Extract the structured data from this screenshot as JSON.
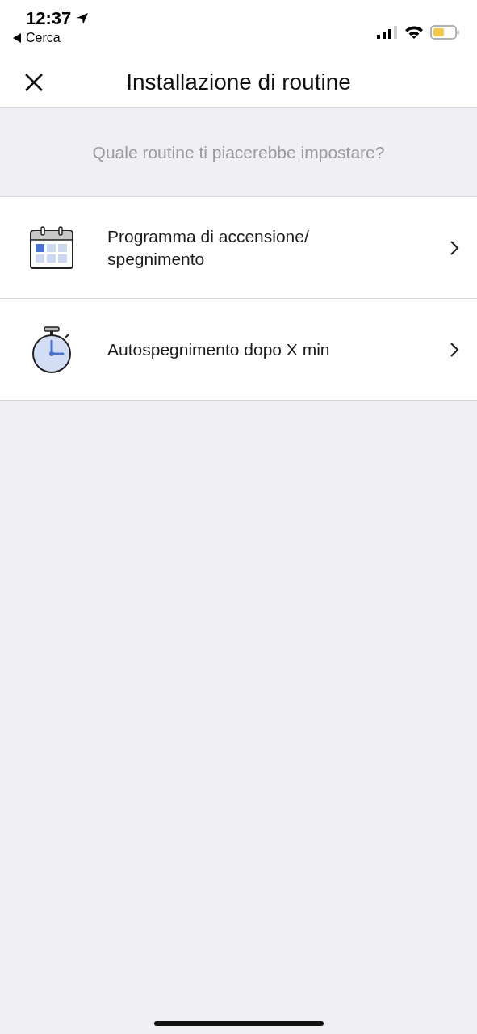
{
  "status_bar": {
    "time": "12:37",
    "back_label": "Cerca"
  },
  "nav": {
    "title": "Installazione di routine"
  },
  "prompt": "Quale routine ti piacerebbe impostare?",
  "routines": [
    {
      "kind": "calendar",
      "lines": [
        "Programma di accensione/",
        "spegnimento"
      ]
    },
    {
      "kind": "stopwatch",
      "lines": [
        "Autospegnimento dopo X min"
      ]
    }
  ]
}
